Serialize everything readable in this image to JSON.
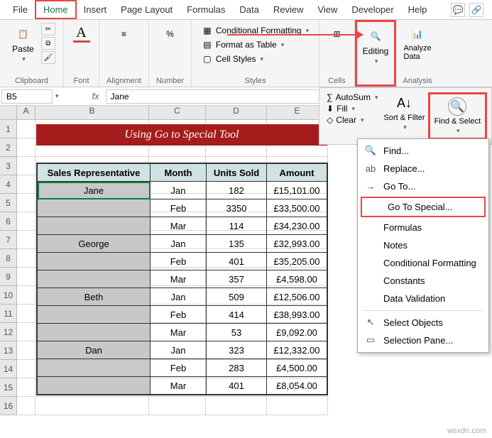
{
  "tabs": {
    "file": "File",
    "home": "Home",
    "insert": "Insert",
    "pageLayout": "Page Layout",
    "formulas": "Formulas",
    "data": "Data",
    "review": "Review",
    "view": "View",
    "developer": "Developer",
    "help": "Help"
  },
  "ribbon": {
    "clipboard": {
      "label": "Clipboard",
      "paste": "Paste"
    },
    "font": {
      "label": "Font"
    },
    "alignment": {
      "label": "Alignment"
    },
    "number": {
      "label": "Number"
    },
    "styles": {
      "label": "Styles",
      "conditional": "Conditional Formatting",
      "formatTable": "Format as Table",
      "cellStyles": "Cell Styles"
    },
    "cells": {
      "label": "Cells"
    },
    "editing": {
      "label": "Editing"
    },
    "analysis": {
      "label": "Analysis",
      "analyze": "Analyze Data"
    }
  },
  "toolPanel": {
    "autosum": "AutoSum",
    "fill": "Fill",
    "clear": "Clear",
    "sortFilter": "Sort & Filter",
    "findSelect": "Find & Select"
  },
  "menu": {
    "find": "Find...",
    "replace": "Replace...",
    "goto": "Go To...",
    "gotoSpecial": "Go To Special...",
    "formulas": "Formulas",
    "notes": "Notes",
    "condFmt": "Conditional Formatting",
    "constants": "Constants",
    "dataVal": "Data Validation",
    "selObjects": "Select Objects",
    "selPane": "Selection Pane..."
  },
  "nameBox": "B5",
  "formulaValue": "Jane",
  "columns": [
    "A",
    "B",
    "C",
    "D",
    "E"
  ],
  "banner": "Using Go to Special Tool",
  "headers": {
    "rep": "Sales Representative",
    "month": "Month",
    "units": "Units Sold",
    "amount": "Amount"
  },
  "rows": [
    {
      "rep": "Jane",
      "month": "Jan",
      "units": "182",
      "amount": "£15,101.00"
    },
    {
      "rep": "",
      "month": "Feb",
      "units": "3350",
      "amount": "£33,500.00"
    },
    {
      "rep": "",
      "month": "Mar",
      "units": "114",
      "amount": "£34,230.00"
    },
    {
      "rep": "George",
      "month": "Jan",
      "units": "135",
      "amount": "£32,993.00"
    },
    {
      "rep": "",
      "month": "Feb",
      "units": "401",
      "amount": "£35,205.00"
    },
    {
      "rep": "",
      "month": "Mar",
      "units": "357",
      "amount": "£4,598.00"
    },
    {
      "rep": "Beth",
      "month": "Jan",
      "units": "509",
      "amount": "£12,506.00"
    },
    {
      "rep": "",
      "month": "Feb",
      "units": "414",
      "amount": "£38,993.00"
    },
    {
      "rep": "",
      "month": "Mar",
      "units": "53",
      "amount": "£9,092.00"
    },
    {
      "rep": "Dan",
      "month": "Jan",
      "units": "323",
      "amount": "£12,332.00"
    },
    {
      "rep": "",
      "month": "Feb",
      "units": "283",
      "amount": "£4,500.00"
    },
    {
      "rep": "",
      "month": "Mar",
      "units": "401",
      "amount": "£8,054.00"
    }
  ],
  "watermark": "wsxdn.com"
}
